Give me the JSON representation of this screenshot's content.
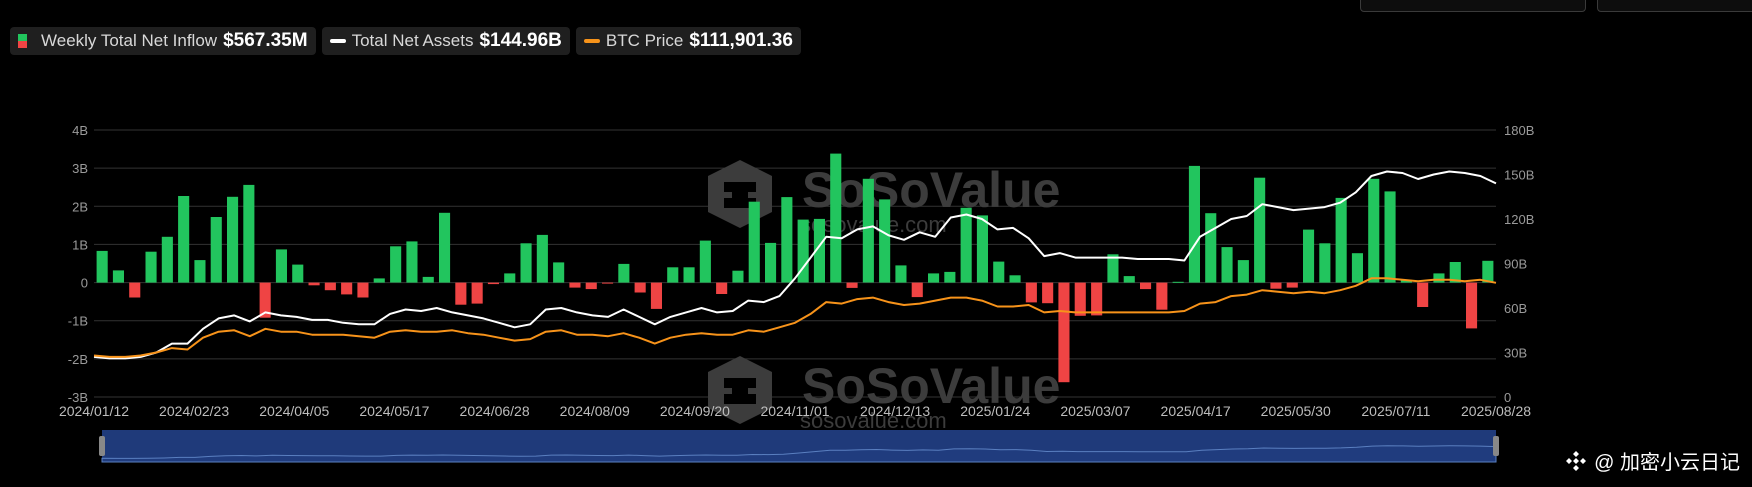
{
  "legend": [
    {
      "label": "Weekly Total Net Inflow",
      "value": "$567.35M",
      "swatch": "bars"
    },
    {
      "label": "Total Net Assets",
      "value": "$144.96B",
      "swatch": "#ffffff"
    },
    {
      "label": "BTC Price",
      "value": "$111,901.36",
      "swatch": "#f7931a"
    }
  ],
  "watermark": {
    "brand": "SoSoValue",
    "url": "sosovalue.com"
  },
  "source_label": "@ 加密小云日记",
  "colors": {
    "inflow_pos": "#22c55e",
    "inflow_neg": "#ef4444",
    "assets": "#ffffff",
    "btc": "#f7931a",
    "grid": "#333333",
    "navigator": "#1f3a7a"
  },
  "chart_data": {
    "type": "bar",
    "x_ticks": [
      "2024/01/12",
      "2024/02/23",
      "2024/04/05",
      "2024/05/17",
      "2024/06/28",
      "2024/08/09",
      "2024/09/20",
      "2024/11/01",
      "2024/12/13",
      "2025/01/24",
      "2025/03/07",
      "2025/04/17",
      "2025/05/30",
      "2025/07/11",
      "2025/08/28"
    ],
    "y_left_ticks": [
      "4B",
      "3B",
      "2B",
      "1B",
      "0",
      "-1B",
      "-2B",
      "-3B"
    ],
    "y_right_ticks": [
      "180B",
      "150B",
      "120B",
      "90B",
      "60B",
      "30B",
      "0"
    ],
    "ylim_left": [
      -3,
      4
    ],
    "ylim_right": [
      0,
      180
    ],
    "grid": true,
    "series": [
      {
        "name": "Weekly Total Net Inflow",
        "type": "bar",
        "axis": "left",
        "unit": "B",
        "values": [
          0.83,
          0.32,
          -0.39,
          0.81,
          1.2,
          2.27,
          0.59,
          1.72,
          2.25,
          2.56,
          -0.92,
          0.87,
          0.47,
          -0.07,
          -0.2,
          -0.31,
          -0.39,
          0.11,
          0.95,
          1.08,
          0.15,
          1.83,
          -0.58,
          -0.55,
          -0.04,
          0.24,
          1.03,
          1.25,
          0.53,
          -0.13,
          -0.17,
          -0.02,
          0.49,
          -0.26,
          -0.69,
          0.4,
          0.4,
          1.1,
          -0.3,
          0.31,
          2.12,
          1.04,
          2.24,
          1.65,
          1.67,
          3.38,
          -0.14,
          2.72,
          2.18,
          0.45,
          -0.38,
          0.24,
          0.28,
          1.96,
          1.76,
          0.55,
          0.19,
          -0.52,
          -0.54,
          -2.61,
          -0.87,
          -0.86,
          0.74,
          0.17,
          -0.17,
          -0.71,
          0.02,
          3.06,
          1.82,
          0.93,
          0.59,
          2.75,
          -0.16,
          -0.13,
          1.39,
          1.03,
          2.22,
          0.77,
          2.72,
          2.39,
          0.07,
          -0.64,
          0.24,
          0.54,
          -1.2,
          0.57
        ]
      },
      {
        "name": "Total Net Assets",
        "type": "line",
        "axis": "right",
        "unit": "B",
        "values": [
          27,
          26,
          26,
          27,
          30,
          36,
          36,
          46,
          53,
          55,
          51,
          57,
          55,
          54,
          52,
          52,
          50,
          49,
          49,
          56,
          59,
          58,
          60,
          57,
          55,
          53,
          50,
          47,
          49,
          59,
          60,
          57,
          55,
          54,
          59,
          54,
          49,
          54,
          57,
          60,
          57,
          58,
          65,
          64,
          68,
          80,
          94,
          108,
          107,
          113,
          115,
          109,
          106,
          111,
          108,
          121,
          123,
          120,
          113,
          114,
          107,
          95,
          97,
          94,
          94,
          94,
          94,
          93,
          93,
          93,
          92,
          108,
          114,
          120,
          122,
          130,
          128,
          126,
          127,
          128,
          131,
          138,
          149,
          152,
          151,
          147,
          150,
          152,
          151,
          149,
          144
        ]
      },
      {
        "name": "BTC Price",
        "type": "line",
        "axis": "right",
        "unit": "K USD",
        "values": [
          28,
          27,
          27,
          28,
          30,
          33,
          32,
          40,
          44,
          45,
          41,
          46,
          44,
          44,
          42,
          42,
          42,
          41,
          40,
          44,
          45,
          44,
          44,
          45,
          43,
          42,
          40,
          38,
          39,
          44,
          45,
          42,
          42,
          41,
          43,
          40,
          36,
          40,
          42,
          43,
          42,
          42,
          45,
          44,
          47,
          50,
          56,
          64,
          63,
          66,
          67,
          64,
          62,
          63,
          65,
          67,
          67,
          65,
          61,
          61,
          62,
          57,
          58,
          57,
          57,
          57,
          57,
          57,
          57,
          57,
          58,
          63,
          64,
          68,
          69,
          72,
          71,
          70,
          71,
          70,
          72,
          75,
          80,
          80,
          79,
          78,
          79,
          79,
          78,
          79,
          77
        ]
      }
    ]
  }
}
